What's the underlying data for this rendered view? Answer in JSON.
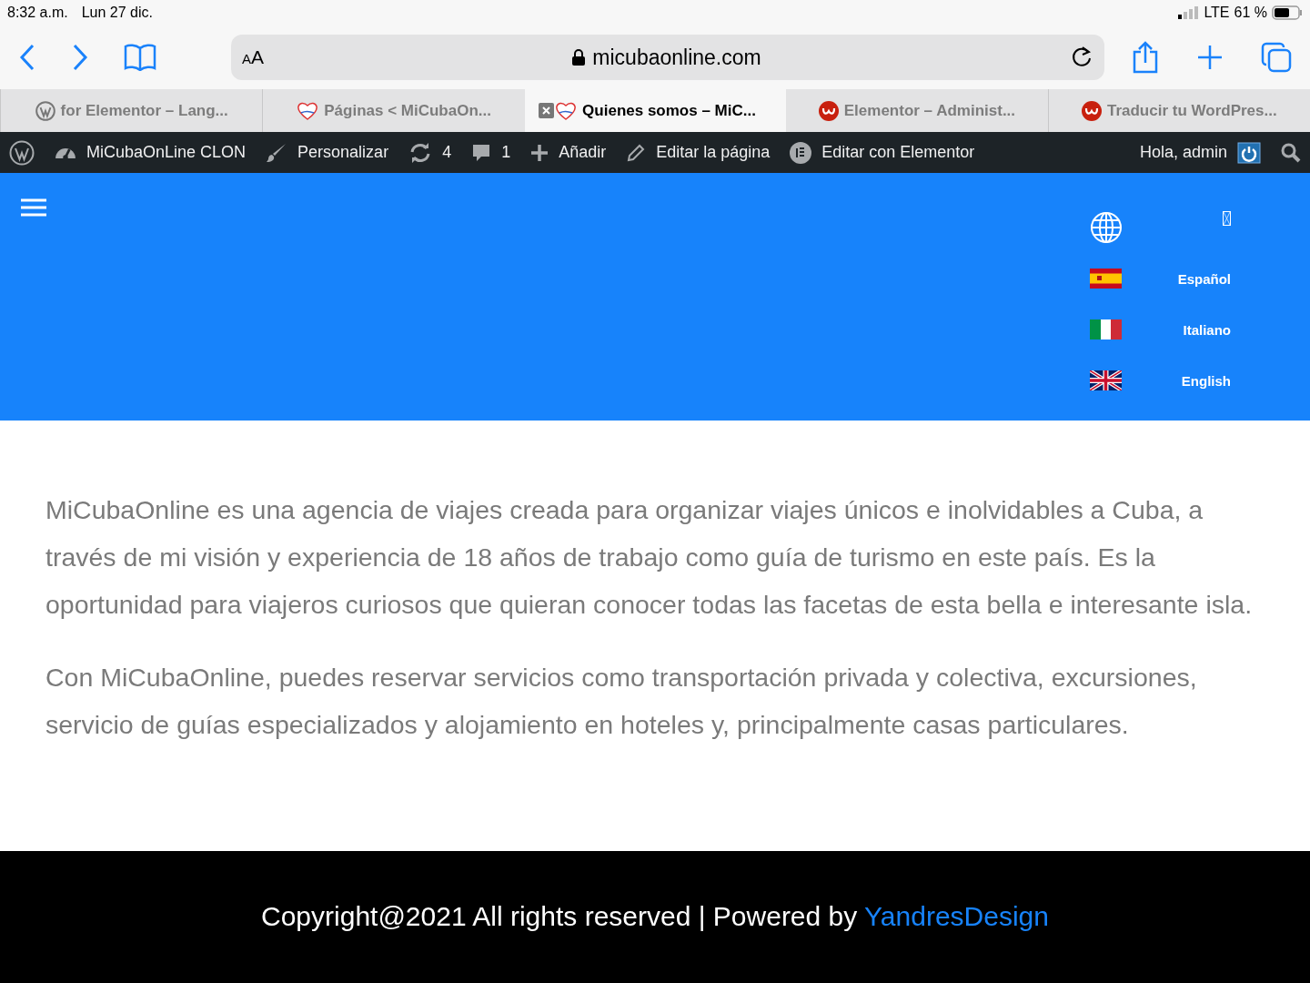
{
  "status_bar": {
    "time": "8:32 a.m.",
    "date": "Lun 27 dic.",
    "network": "LTE",
    "battery": "61 %"
  },
  "address_bar": {
    "text_size": "AA",
    "url": "micubaonline.com"
  },
  "tabs": [
    {
      "title": "for Elementor – Lang...",
      "kind": "wordpress",
      "selected": false
    },
    {
      "title": "Páginas < MiCubaOn...",
      "kind": "heart",
      "selected": false
    },
    {
      "title": "Quienes somos – MiC...",
      "kind": "heart",
      "selected": true
    },
    {
      "title": "Elementor – Administ...",
      "kind": "w",
      "selected": false
    },
    {
      "title": "Traducir tu WordPres...",
      "kind": "w",
      "selected": false
    }
  ],
  "admin_bar": {
    "items": [
      {
        "kind": "dashboard",
        "label": "MiCubaOnLine CLON"
      },
      {
        "kind": "brush",
        "label": "Personalizar"
      },
      {
        "kind": "updates",
        "label": "4"
      },
      {
        "kind": "comments",
        "label": "1"
      },
      {
        "kind": "plus",
        "label": "Añadir"
      },
      {
        "kind": "pencil",
        "label": "Editar la página"
      },
      {
        "kind": "elementor",
        "label": "Editar con Elementor"
      }
    ],
    "greeting": "Hola, admin"
  },
  "languages": [
    {
      "label": "Español",
      "kind": "es"
    },
    {
      "label": "Italiano",
      "kind": "it"
    },
    {
      "label": "English",
      "kind": "gb"
    }
  ],
  "paragraphs": [
    "MiCubaOnline es una agencia de viajes creada para organizar viajes únicos e inolvidables a Cuba, a través de mi visión y experiencia de 18 años de trabajo como guía de turismo en este país. Es la oportunidad para viajeros curiosos que quieran conocer todas las facetas de esta bella e interesante isla.",
    "Con MiCubaOnline, puedes reservar servicios como transportación privada y colectiva, excursiones, servicio de guías especializados y alojamiento en hoteles y, principalmente casas particulares."
  ],
  "footer": {
    "text": "Copyright@2021 All rights reserved | Powered by",
    "link": "YandresDesign"
  }
}
